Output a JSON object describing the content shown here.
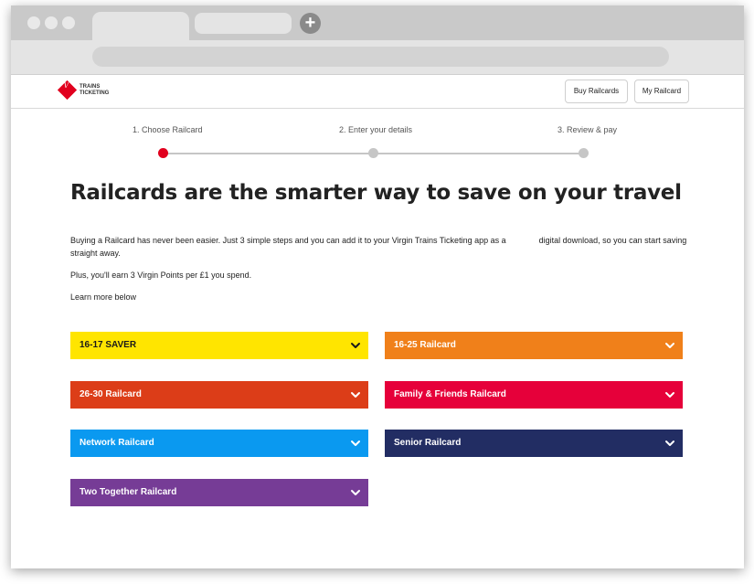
{
  "header": {
    "logo_text": "TRAINS TICKETING",
    "buy_button": "Buy Railcards",
    "my_button": "My Railcard"
  },
  "steps": [
    {
      "label": "1. Choose Railcard",
      "active": true
    },
    {
      "label": "2. Enter your details",
      "active": false
    },
    {
      "label": "3. Review & pay",
      "active": false
    }
  ],
  "main": {
    "title": "Railcards are the smarter way to save on your travel",
    "intro_part1": "Buying a Railcard has never been easier. Just 3 simple steps and you can add it to your Virgin Trains Ticketing app as a",
    "intro_part2": "digital download, so you can start saving",
    "intro_part3": "straight away.",
    "points": "Plus, you'll earn 3 Virgin Points per £1 you spend.",
    "learn_more": "Learn more below"
  },
  "cards": [
    {
      "label": "16-17 SAVER",
      "color": "#ffe500"
    },
    {
      "label": "16-25 Railcard",
      "color": "#f0801a"
    },
    {
      "label": "26-30 Railcard",
      "color": "#dc3d18"
    },
    {
      "label": "Family & Friends Railcard",
      "color": "#e6003a"
    },
    {
      "label": "Network Railcard",
      "color": "#0a99f0"
    },
    {
      "label": "Senior Railcard",
      "color": "#222d63"
    },
    {
      "label": "Two Together Railcard",
      "color": "#763c96"
    }
  ],
  "icons": {
    "card_expand": "chevron-down-icon",
    "new_tab": "plus-icon",
    "logo": "virgin-logo-icon"
  }
}
